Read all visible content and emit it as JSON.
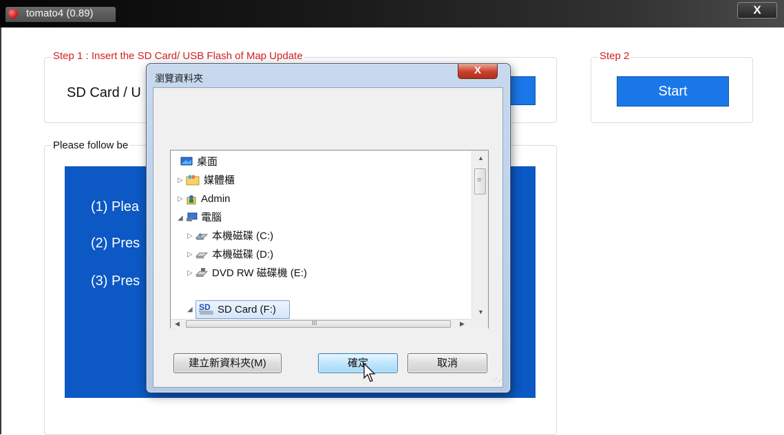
{
  "window": {
    "title": "tomato4 (0.89)",
    "close_label": "X"
  },
  "step1": {
    "title": "Step 1 : Insert the SD Card/ USB Flash of Map Update",
    "device_label_partial": "SD Card / U"
  },
  "step2": {
    "title": "Step 2",
    "start_label": "Start"
  },
  "instructions": {
    "title_partial": "Please follow be",
    "lines": [
      "(1) Plea",
      "(2) Pres",
      "(3) Pres"
    ]
  },
  "dialog": {
    "title": "瀏覽資料夾",
    "close_label": "X",
    "tree": [
      {
        "label": "桌面",
        "icon": "desktop-icon",
        "expander": "",
        "indent": 0
      },
      {
        "label": "媒體櫃",
        "icon": "library-icon",
        "expander": "▷",
        "indent": 0
      },
      {
        "label": "Admin",
        "icon": "user-folder-icon",
        "expander": "▷",
        "indent": 0
      },
      {
        "label": "電腦",
        "icon": "computer-icon",
        "expander": "◢",
        "indent": 0
      },
      {
        "label": "本機磁碟 (C:)",
        "icon": "system-drive-icon",
        "expander": "▷",
        "indent": 1
      },
      {
        "label": "本機磁碟 (D:)",
        "icon": "drive-icon",
        "expander": "▷",
        "indent": 1
      },
      {
        "label": "DVD RW 磁碟機 (E:)",
        "icon": "dvd-drive-icon",
        "expander": "▷",
        "indent": 1
      },
      {
        "label": "SD Card (F:)",
        "icon": "sd-card-icon",
        "expander": "◢",
        "indent": 1,
        "selected": true
      }
    ],
    "sd_badge": "SD",
    "hscroll_grip": "III",
    "vscroll_grip": "≡",
    "buttons": {
      "new_folder": "建立新資料夾(M)",
      "ok": "確定",
      "cancel": "取消"
    }
  },
  "colors": {
    "accent_blue": "#1a77e8",
    "panel_blue": "#0c58c4",
    "step1_red": "#d21f1f"
  }
}
